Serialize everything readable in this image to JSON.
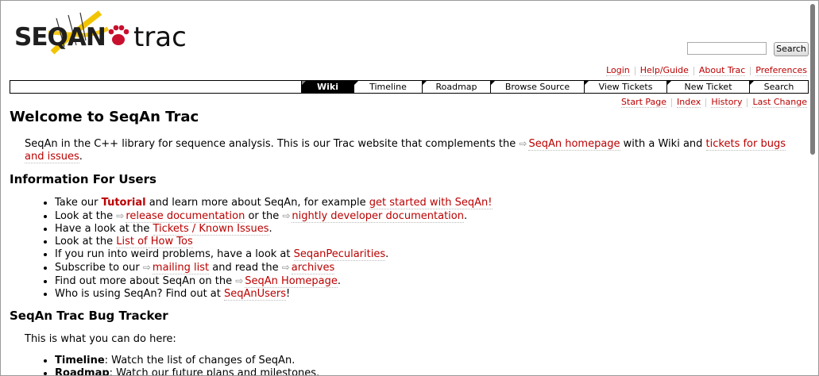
{
  "logo": {
    "seq_text": "SEQAN",
    "trac_text": "trac"
  },
  "search": {
    "placeholder": "",
    "button_label": "Search"
  },
  "metanav": [
    "Login",
    "Help/Guide",
    "About Trac",
    "Preferences"
  ],
  "mainnav": [
    "Wiki",
    "Timeline",
    "Roadmap",
    "Browse Source",
    "View Tickets",
    "New Ticket",
    "Search"
  ],
  "ctxnav": [
    "Start Page",
    "Index",
    "History",
    "Last Change"
  ],
  "page": {
    "title": "Welcome to SeqAn Trac",
    "intro": {
      "t1": "SeqAn in the C++ library for sequence analysis. This is our Trac website that complements the ",
      "link1": "SeqAn homepage",
      "t2": " with a Wiki and ",
      "link2": "tickets for bugs and issues",
      "t3": "."
    },
    "users_heading": "Information For Users",
    "users_items": [
      {
        "pre": "Take our ",
        "bold_link": "Tutorial",
        "mid": " and learn more about SeqAn, for example ",
        "link": "get started with SeqAn!",
        "post": ""
      },
      {
        "pre": "Look at the ",
        "ext_link": "release documentation",
        "mid": " or the ",
        "ext_link2": "nightly developer documentation",
        "post": "."
      },
      {
        "pre": "Have a look at the ",
        "link": "Tickets / Known Issues",
        "post": "."
      },
      {
        "pre": "Look at the ",
        "link": "List of How Tos",
        "post": ""
      },
      {
        "pre": "If you run into weird problems, have a look at ",
        "link": "SeqanPecularities",
        "post": "."
      },
      {
        "pre": "Subscribe to our ",
        "ext_link": "mailing list",
        "mid": " and read the ",
        "ext_link2": "archives",
        "post": ""
      },
      {
        "pre": "Find out more about SeqAn on the ",
        "ext_link": "SeqAn Homepage",
        "post": "."
      },
      {
        "pre": "Who is using SeqAn? Find out at ",
        "link": "SeqAnUsers",
        "post": "!"
      }
    ],
    "tracker_heading": "SeqAn Trac Bug Tracker",
    "tracker_intro": "This is what you can do here:",
    "tracker_items": [
      {
        "bold": "Timeline",
        "text": ": Watch the list of changes of SeqAn."
      },
      {
        "bold": "Roadmap",
        "text": ": Watch our future plans and milestones."
      }
    ]
  },
  "colors": {
    "link": "#bb0000",
    "nav_active_bg": "#000000",
    "logo_yellow": "#f2c400",
    "paw_red": "#c8102e"
  }
}
